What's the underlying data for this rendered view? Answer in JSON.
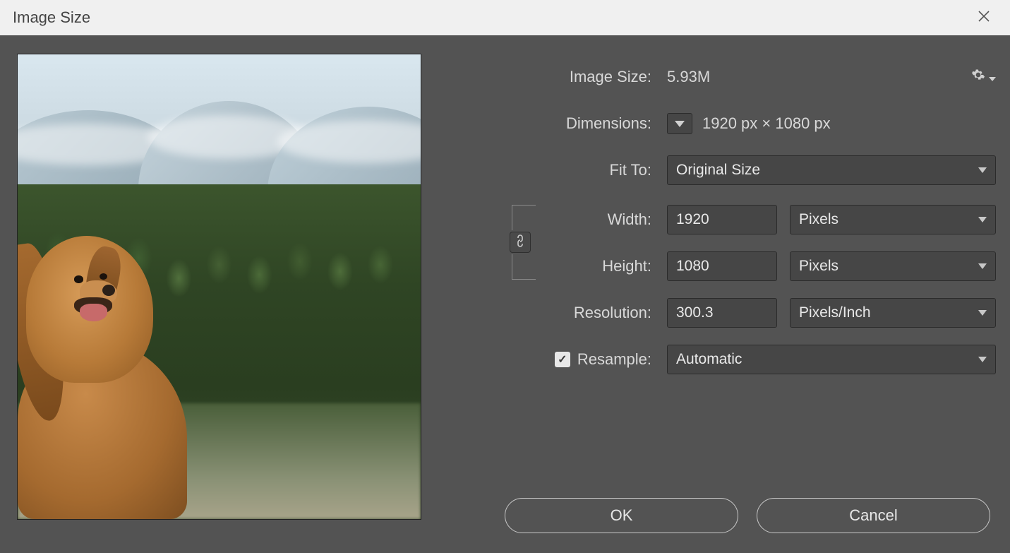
{
  "titlebar": {
    "title": "Image Size"
  },
  "info": {
    "image_size_label": "Image Size:",
    "image_size_value": "5.93M",
    "dimensions_label": "Dimensions:",
    "dimensions_value": "1920 px  ×  1080 px"
  },
  "fit": {
    "label": "Fit To:",
    "value": "Original Size"
  },
  "width": {
    "label": "Width:",
    "value": "1920",
    "unit": "Pixels"
  },
  "height": {
    "label": "Height:",
    "value": "1080",
    "unit": "Pixels"
  },
  "resolution": {
    "label": "Resolution:",
    "value": "300.3",
    "unit": "Pixels/Inch"
  },
  "resample": {
    "label": "Resample:",
    "checked": true,
    "value": "Automatic"
  },
  "buttons": {
    "ok": "OK",
    "cancel": "Cancel"
  }
}
